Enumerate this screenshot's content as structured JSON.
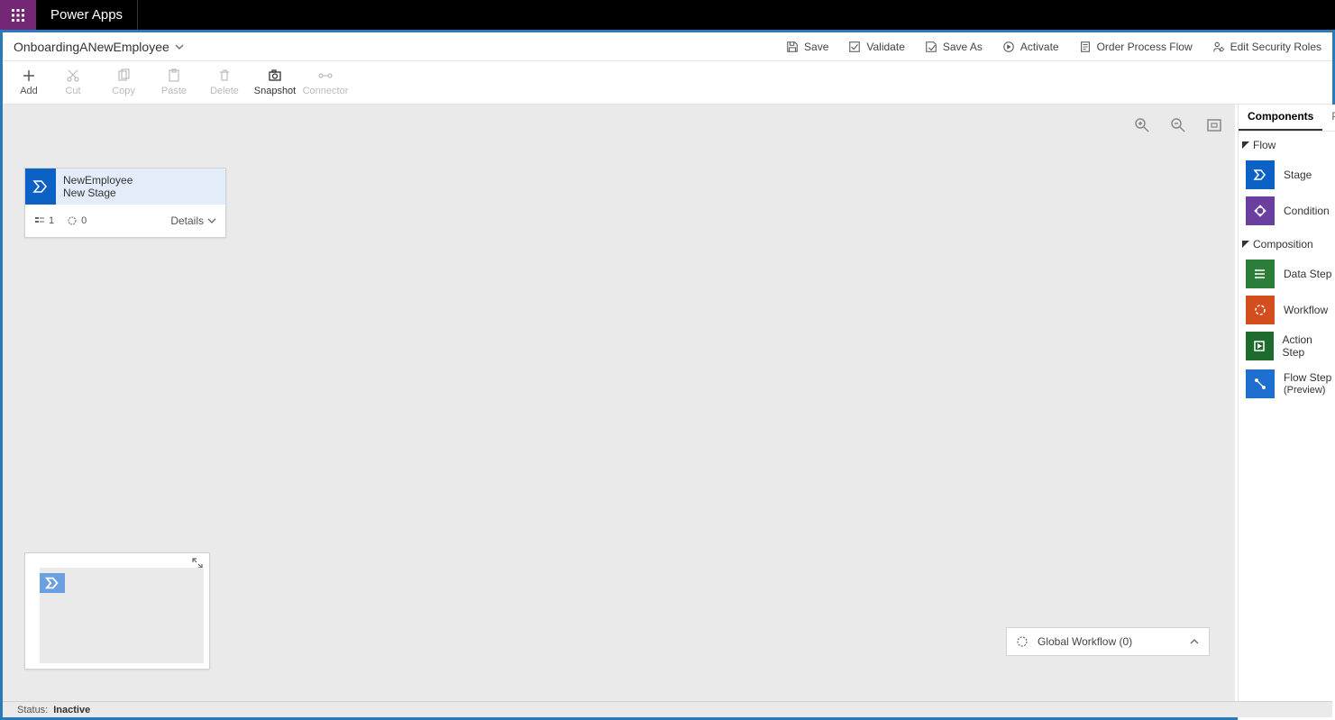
{
  "app_title": "Power Apps",
  "process_name": "OnboardingANewEmployee",
  "cmd": {
    "save": "Save",
    "validate": "Validate",
    "saveas": "Save As",
    "activate": "Activate",
    "order": "Order Process Flow",
    "security": "Edit Security Roles"
  },
  "tools": {
    "add": "Add",
    "cut": "Cut",
    "copy": "Copy",
    "paste": "Paste",
    "delete": "Delete",
    "snapshot": "Snapshot",
    "connector": "Connector"
  },
  "stage": {
    "entity": "NewEmployee",
    "name": "New Stage",
    "steps": "1",
    "workflows": "0",
    "details": "Details"
  },
  "global_wf": "Global Workflow (0)",
  "status_label": "Status:",
  "status_value": "Inactive",
  "panel": {
    "tab_components": "Components",
    "tab_properties": "Pro",
    "section_flow": "Flow",
    "section_composition": "Composition",
    "stage": "Stage",
    "condition": "Condition",
    "datastep": "Data Step",
    "workflow": "Workflow",
    "actionstep": "Action Step",
    "flowstep_l1": "Flow Step",
    "flowstep_l2": "(Preview)"
  }
}
